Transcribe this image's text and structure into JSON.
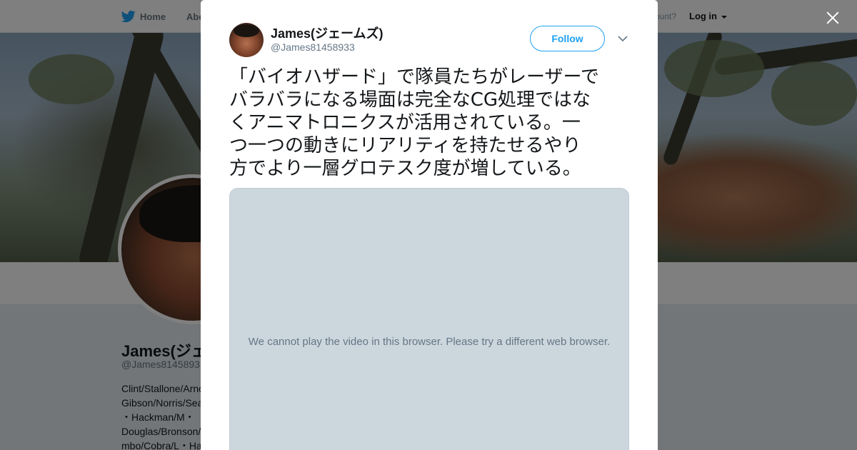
{
  "nav": {
    "home_label": "Home",
    "about_label": "Abo",
    "account_prompt": "ccount?",
    "login_label": "Log in"
  },
  "profile": {
    "name": "James(ジェ",
    "handle": "@James8145893",
    "bio_lines": [
      "Clint/Stallone/Arnο",
      "Gibson/Norris/Sea",
      "・Hackman/M・",
      "Douglas/Bronson/",
      "mbo/Cobra/L・Ha"
    ]
  },
  "tweet": {
    "name": "James(ジェームズ)",
    "handle": "@James81458933",
    "follow_label": "Follow",
    "text_lines": [
      "「バイオハザード」で隊員たちがレーザーで",
      "バラバラになる場面は完全なCG処理ではな",
      "くアニマトロニクスが活用されている。一",
      "つ一つの動きにリアリティを持たせるやり",
      "方でより一層グロテスク度が増している。"
    ],
    "video_message": "We cannot play the video in this browser. Please try a different web browser."
  },
  "colors": {
    "brand_blue": "#1da1f2",
    "text_primary": "#14171a",
    "text_secondary": "#657786",
    "video_placeholder": "#ccd6dd"
  },
  "icons": {
    "home": "twitter-bird-icon",
    "close": "close-icon",
    "more": "chevron-down-icon"
  }
}
